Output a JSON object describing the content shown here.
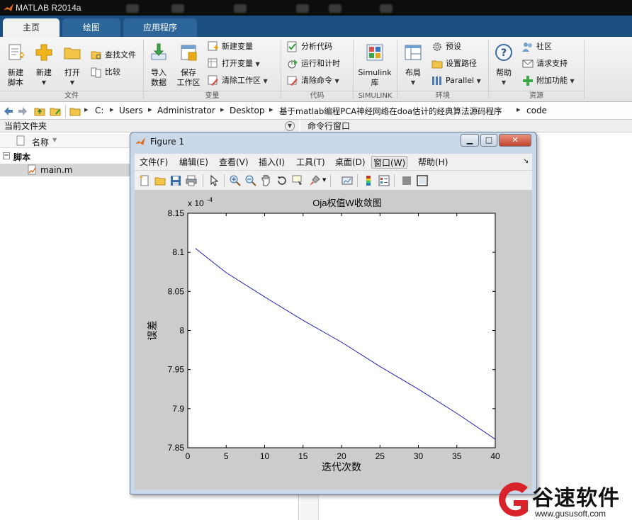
{
  "app": {
    "title": "MATLAB R2014a"
  },
  "ribbon": {
    "tabs": [
      "主页",
      "绘图",
      "应用程序"
    ],
    "active_tab": 0,
    "groups": {
      "file": {
        "label": "文件",
        "new_script": [
          "新建",
          "脚本"
        ],
        "new": "新建",
        "open": "打开",
        "find_files": "查找文件",
        "compare": "比较"
      },
      "variable": {
        "label": "变量",
        "import": [
          "导入",
          "数据"
        ],
        "save_workspace": [
          "保存",
          "工作区"
        ],
        "new_variable": "新建变量",
        "open_variable": "打开变量",
        "clear_workspace": "清除工作区"
      },
      "code": {
        "label": "代码",
        "analyze": "分析代码",
        "run_time": "运行和计时",
        "clear_commands": "清除命令"
      },
      "simulink": {
        "label": "SIMULINK",
        "simulink": [
          "Simulink",
          "库"
        ]
      },
      "environment": {
        "label": "环境",
        "layout": "布局",
        "preferences": "预设",
        "set_path": "设置路径",
        "parallel": "Parallel"
      },
      "resources": {
        "label": "资源",
        "help": "帮助",
        "community": "社区",
        "request_support": "请求支持",
        "addons": "附加功能"
      }
    }
  },
  "address": {
    "crumbs": [
      "C:",
      "Users",
      "Administrator",
      "Desktop",
      "基于matlab编程PCA神经网络在doa估计的经典算法源码程序",
      "code"
    ]
  },
  "left_panel": {
    "title": "当前文件夹",
    "column": "名称",
    "section": "脚本",
    "file": "main.m"
  },
  "right_panel": {
    "title": "命令行窗口"
  },
  "figure": {
    "title": "Figure 1",
    "menu": [
      "文件(F)",
      "编辑(E)",
      "查看(V)",
      "插入(I)",
      "工具(T)",
      "桌面(D)",
      "窗口(W)",
      "帮助(H)"
    ],
    "selected_menu": 6,
    "toolbar_icons": [
      "new-figure-icon",
      "open-file-icon",
      "save-icon",
      "print-icon",
      "pointer-icon",
      "zoom-in-icon",
      "zoom-out-icon",
      "pan-hand-icon",
      "rotate-3d-icon",
      "data-cursor-icon",
      "brush-icon",
      "link-plot-icon",
      "colorbar-icon",
      "legend-icon",
      "hide-plot-tools-icon",
      "show-plot-tools-icon"
    ]
  },
  "chart_data": {
    "type": "line",
    "title": "Oja权值W收敛图",
    "xlabel": "迭代次数",
    "ylabel": "误差",
    "y_exponent_label": "x 10",
    "y_exponent_power": "-4",
    "xlim": [
      0,
      40
    ],
    "ylim": [
      7.85,
      8.15
    ],
    "xticks": [
      0,
      5,
      10,
      15,
      20,
      25,
      30,
      35,
      40
    ],
    "yticks": [
      7.85,
      7.9,
      7.95,
      8,
      8.05,
      8.1,
      8.15
    ],
    "ytick_labels": [
      "7.85",
      "7.9",
      "7.95",
      "8",
      "8.05",
      "8.1",
      "8.15"
    ],
    "series": [
      {
        "color": "#1f1fb4",
        "x": [
          1,
          5,
          10,
          15,
          20,
          25,
          30,
          35,
          40
        ],
        "y": [
          8.105,
          8.074,
          8.043,
          8.013,
          7.985,
          7.954,
          7.925,
          7.894,
          7.861
        ]
      }
    ]
  },
  "watermark": {
    "brand": "谷速软件",
    "url": "www.gususoft.com",
    "color": "#d8232a"
  }
}
